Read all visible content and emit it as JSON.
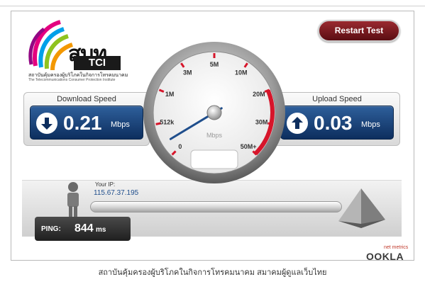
{
  "logo": {
    "wordmark": "สบท",
    "tci": "TCI",
    "caption_th": "สถาบันคุ้มครองผู้บริโภคในกิจการโทรคมนาคม",
    "caption_en": "The Telecommunications Consumer Protection Institute"
  },
  "restart": {
    "label": "Restart Test"
  },
  "download": {
    "label": "Download Speed",
    "value": "0.21",
    "unit": "Mbps"
  },
  "upload": {
    "label": "Upload Speed",
    "value": "0.03",
    "unit": "Mbps"
  },
  "gauge": {
    "ticks": [
      "0",
      "512k",
      "1M",
      "3M",
      "5M",
      "10M",
      "20M",
      "30M",
      "50M+"
    ],
    "unit": "Mbps",
    "needle_value": "0.21"
  },
  "ip": {
    "label": "Your IP:",
    "value": "115.67.37.195"
  },
  "ping": {
    "label": "PING:",
    "value": "844",
    "unit": "ms"
  },
  "brand": {
    "small": "net metrics",
    "name": "OOKLA"
  },
  "footer": {
    "text": "สถาบันคุ้มครองผู้บริโภคในกิจการโทรคมนาคม สมาคมผู้ดูแลเว็บไทย"
  }
}
